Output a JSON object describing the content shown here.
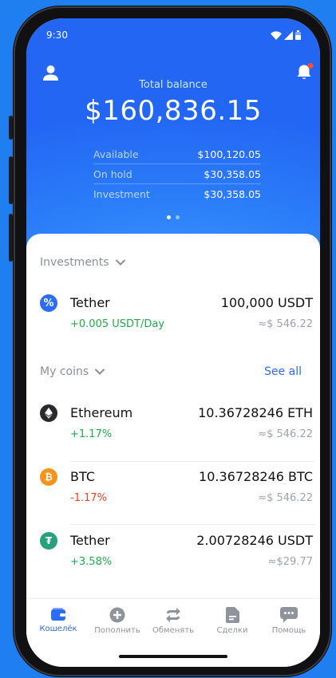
{
  "status": {
    "time": "9:30"
  },
  "balance": {
    "label": "Total balance",
    "total": "$160,836.15",
    "rows": [
      {
        "label": "Available",
        "value": "$100,120.05"
      },
      {
        "label": "On hold",
        "value": "$30,358.05"
      },
      {
        "label": "Investment",
        "value": "$30,358.05"
      }
    ]
  },
  "investments": {
    "title": "Investments",
    "item": {
      "name": "Tether",
      "amount": "100,000 USDT",
      "change": "+0.005 USDT/Day",
      "fiat": "≈$ 546.22"
    }
  },
  "coins": {
    "title": "My coins",
    "see_all": "See all",
    "items": [
      {
        "name": "Ethereum",
        "amount": "10.36728246 ETH",
        "change": "+1.17%",
        "fiat": "≈$ 546.22"
      },
      {
        "name": "BTC",
        "amount": "10.36728246 BTC",
        "change": "-1.17%",
        "fiat": "≈$ 546.22"
      },
      {
        "name": "Tether",
        "amount": "2.00728246 USDT",
        "change": "+3.58%",
        "fiat": "≈$29.77"
      }
    ]
  },
  "tabs": [
    {
      "label": "Кошелёк"
    },
    {
      "label": "Пополнить"
    },
    {
      "label": "Обменять"
    },
    {
      "label": "Сделки"
    },
    {
      "label": "Помощь"
    }
  ],
  "colors": {
    "accent": "#2b6df5",
    "positive": "#1fae4a",
    "negative": "#f1431f",
    "eth": "#2a2a2e",
    "btc": "#f7931a",
    "tether": "#26a17b",
    "invest": "#2b6df5"
  },
  "icons": {
    "profile": "user-icon",
    "notifications": "bell-icon",
    "wallet": "wallet-icon",
    "deposit": "plus-circle-icon",
    "exchange": "swap-arrows-icon",
    "deals": "document-icon",
    "help": "chat-bubble-icon"
  }
}
